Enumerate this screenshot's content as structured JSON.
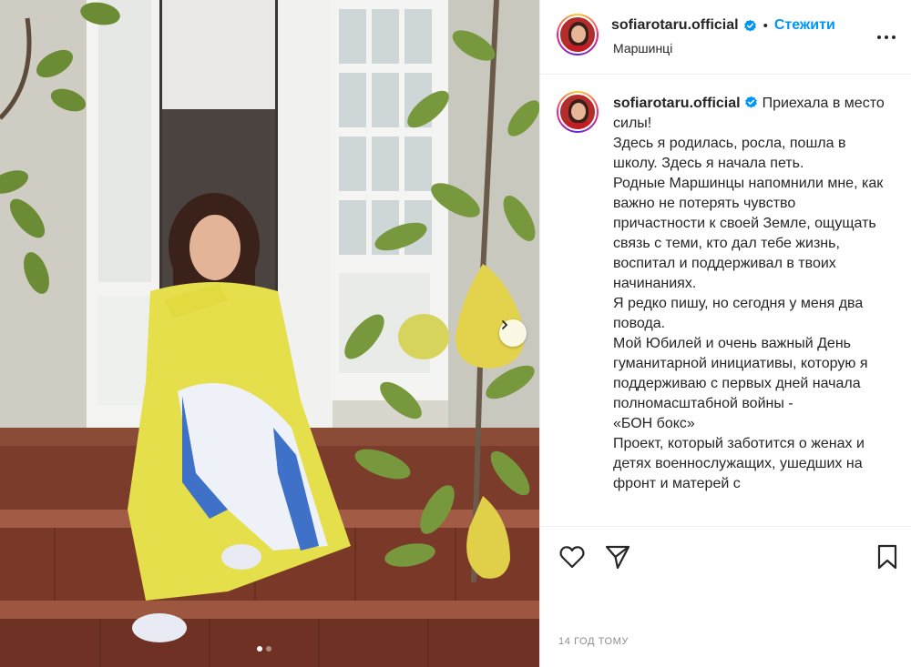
{
  "header": {
    "username": "sofiarotaru.official",
    "separator": "•",
    "follow_label": "Стежити",
    "location": "Маршинці"
  },
  "post": {
    "username": "sofiarotaru.official",
    "caption_lines": [
      "Приехала в место силы!",
      "Здесь я родилась, росла, пошла в школу. Здесь я начала петь.",
      "Родные Маршинцы напомнили мне, как важно не потерять чувство причастности к своей Земле, ощущать связь с теми, кто дал тебе жизнь, воспитал и поддерживал в твоих начинаниях.",
      "Я редко пишу, но сегодня у меня два повода.",
      "Мой Юбилей и очень важный День гуманитарной инициативы, которую я поддерживаю с первых дней начала полномасштабной войны -",
      "«БОН бокс»",
      "Проект, который заботится о женах и детях военнослужащих, ушедших на фронт и матерей с"
    ],
    "timestamp": "14 ГОД ТОМУ",
    "carousel": {
      "current": 1,
      "total": 2
    }
  },
  "icons": {
    "verified": "verified-badge-icon",
    "more": "more-options-icon",
    "like": "heart-icon",
    "share": "paper-plane-icon",
    "save": "bookmark-icon",
    "next": "chevron-right-icon"
  },
  "colors": {
    "accent": "#0095f6",
    "text": "#262626",
    "muted": "#8e8e8e"
  }
}
